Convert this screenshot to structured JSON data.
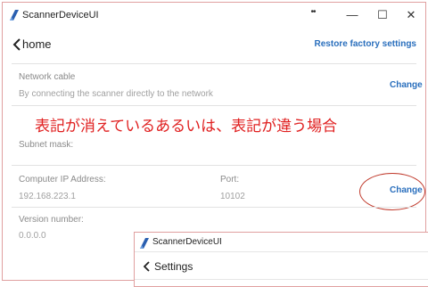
{
  "window": {
    "title": "ScannerDeviceUI",
    "controls": {
      "dots": "••",
      "minimize": "—",
      "maximize": "☐",
      "close": "✕"
    }
  },
  "nav": {
    "back_label": "home",
    "restore_label": "Restore factory settings"
  },
  "network": {
    "label": "Network cable",
    "description": "By connecting the scanner directly to the network",
    "change_label": "Change"
  },
  "annotation_text": "表記が消えているあるいは、表記が違う場合",
  "subnet": {
    "label": "Subnet mask:"
  },
  "ip": {
    "label": "Computer IP Address:",
    "value": "192.168.223.1",
    "port_label": "Port:",
    "port_value": "10102",
    "change_label": "Change"
  },
  "version": {
    "label": "Version number:",
    "value": "0.0.0.0"
  },
  "overlay": {
    "title": "ScannerDeviceUI",
    "back_label": "Settings"
  },
  "colors": {
    "link": "#2a6fbd",
    "annotation": "#e02020",
    "ellipse": "#c0392b",
    "app_icon": "#2a5fb0"
  },
  "icons": {
    "app": "scanner-app-icon",
    "back": "chevron-left-icon"
  }
}
